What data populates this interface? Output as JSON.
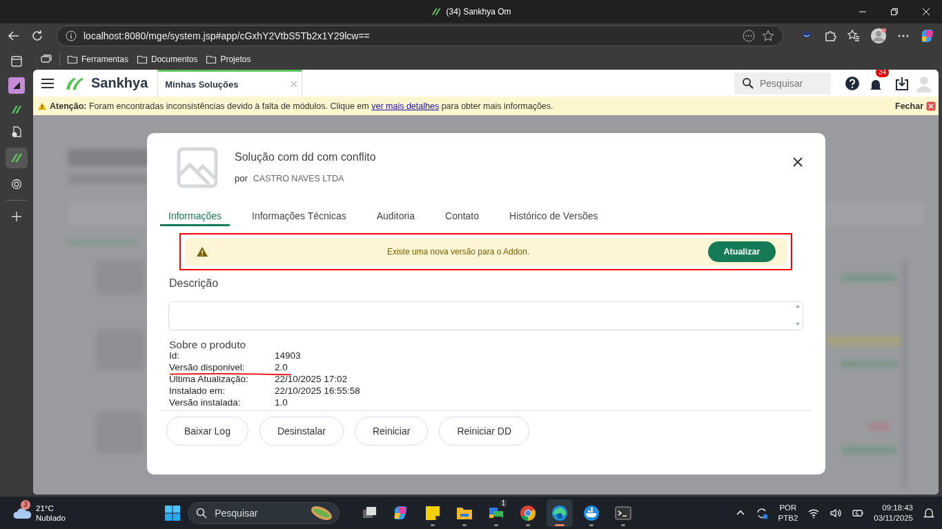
{
  "window": {
    "title": "(34) Sankhya Om"
  },
  "address_bar": {
    "url": "localhost:8080/mge/system.jsp#app/cGxhY2VtbS5Tb2x1Y29lcw=="
  },
  "bookmarks": [
    "Ferramentas",
    "Documentos",
    "Projetos"
  ],
  "app_header": {
    "logo": "Sankhya",
    "tab": "Minhas Soluções",
    "search": {
      "placeholder": "Pesquisar"
    },
    "notifications": "34"
  },
  "warning_bar": {
    "text": "**Atenção:** Foram encontradas inconsistências devido à falta de módulos. Clique em",
    "link": "ver mais detalhes",
    "text_after": "para obter mais informações.",
    "close": "Fechar"
  },
  "modal": {
    "title": "Solução com dd com conflito",
    "by_label": "por",
    "vendor": "CASTRO NAVES LTDA",
    "tabs": [
      {
        "label": "Informações",
        "selected": true
      },
      {
        "label": "Informações Técnicas",
        "selected": false
      },
      {
        "label": "Auditoria",
        "selected": false
      },
      {
        "label": "Contato",
        "selected": false
      },
      {
        "label": "Histórico de Versões",
        "selected": false
      }
    ],
    "alert": {
      "text": "Existe uma nova versão para o Addon.",
      "button": "Atualizar"
    },
    "description_label": "Descrição",
    "about_heading": "Sobre o produto",
    "fields": [
      {
        "label": "Id:",
        "value": "14903"
      },
      {
        "label": "Versão disponivel:",
        "value": "2.0"
      },
      {
        "label": "Última Atualização:",
        "value": "22/10/2025 17:02"
      },
      {
        "label": "Instalado em:",
        "value": "22/10/2025 16:55:58"
      },
      {
        "label": "Versão instalada:",
        "value": "1.0"
      }
    ],
    "buttons": [
      "Baixar Log",
      "Desinstalar",
      "Reiniciar",
      "Reiniciar DD"
    ]
  },
  "taskbar": {
    "weather": {
      "badge": "3",
      "temperature": "21°C",
      "condition": "Nublado"
    },
    "search": {
      "placeholder": "Pesquisar"
    },
    "apps": [
      {
        "kind": "taskview",
        "active": false
      },
      {
        "kind": "copilot",
        "active": false
      },
      {
        "kind": "notes",
        "active": false
      },
      {
        "kind": "folder",
        "active": false
      },
      {
        "kind": "chat",
        "active": false,
        "badge": "1"
      },
      {
        "kind": "chrome",
        "active": false
      },
      {
        "kind": "edge",
        "active": true
      },
      {
        "kind": "docker",
        "active": false
      },
      {
        "kind": "terminal",
        "active": false
      }
    ],
    "language": "POR",
    "layout": "PTB2",
    "time": "09:18:43",
    "date": "03/11/2025"
  }
}
